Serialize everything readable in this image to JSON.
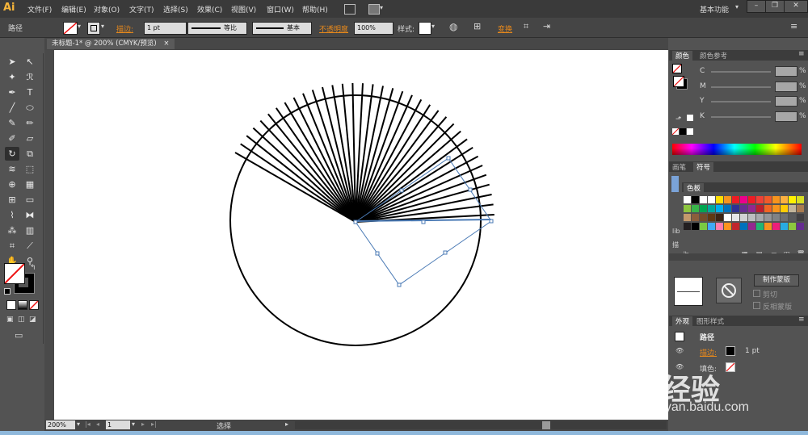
{
  "app": {
    "logo": "Ai",
    "workspace": "基本功能"
  },
  "menu": [
    "文件(F)",
    "编辑(E)",
    "对象(O)",
    "文字(T)",
    "选择(S)",
    "效果(C)",
    "视图(V)",
    "窗口(W)",
    "帮助(H)"
  ],
  "control": {
    "object_type": "路径",
    "stroke_label": "描边:",
    "stroke_weight": "1 pt",
    "profile": "等比",
    "brush": "基本",
    "opacity_label": "不透明度",
    "opacity_value": "100%",
    "style_label": "样式:",
    "transform_label": "变换"
  },
  "document": {
    "tab_title": "未标题-1* @ 200% (CMYK/预览)",
    "close": "×"
  },
  "status": {
    "zoom": "200%",
    "page": "1",
    "tool": "选择"
  },
  "color_panel": {
    "tabs": [
      "颜色",
      "颜色参考"
    ],
    "channels": [
      {
        "label": "C",
        "unit": "%"
      },
      {
        "label": "M",
        "unit": "%"
      },
      {
        "label": "Y",
        "unit": "%"
      },
      {
        "label": "K",
        "unit": "%"
      }
    ]
  },
  "brush_panel": {
    "tabs": [
      "画笔",
      "符号"
    ]
  },
  "swatch_panel": {
    "tab": "色板"
  },
  "transparency": {
    "make_mask": "制作蒙版",
    "clip": "剪切",
    "invert": "反相蒙版"
  },
  "appearance": {
    "tabs": [
      "外观",
      "图形样式"
    ],
    "object": "路径",
    "stroke_label": "描边:",
    "stroke_value": "1 pt",
    "fill_label": "填色:"
  },
  "watermark": {
    "brand": "Bai 经验",
    "url": "jingyan.baidu.com"
  },
  "colors": {
    "accent_orange": "#e8891b",
    "selection_blue": "#4a7ab5",
    "panel_bg": "#535353"
  }
}
